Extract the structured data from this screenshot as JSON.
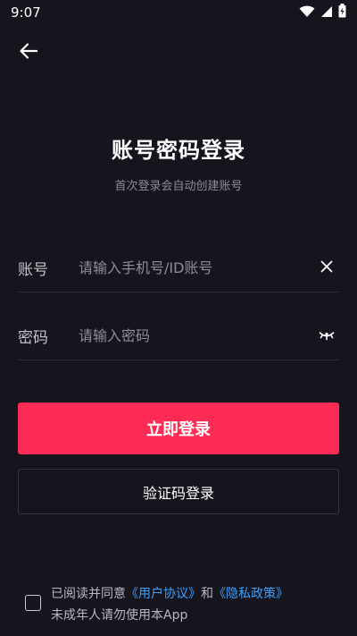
{
  "status_bar": {
    "time": "9:07",
    "icons": [
      "wifi-icon",
      "signal-icon",
      "battery-icon"
    ]
  },
  "header": {
    "back_icon": "arrow-left-icon"
  },
  "title": "账号密码登录",
  "subtitle": "首次登录会自动创建账号",
  "account_field": {
    "label": "账号",
    "placeholder": "请输入手机号/ID账号",
    "value": "",
    "clear_icon": "close-icon"
  },
  "password_field": {
    "label": "密码",
    "placeholder": "请输入密码",
    "value": "",
    "toggle_icon": "eye-closed-icon"
  },
  "buttons": {
    "login": "立即登录",
    "code_login": "验证码登录"
  },
  "agreement": {
    "prefix": "已阅读并同意",
    "user_agreement": "《用户协议》",
    "and": "和",
    "privacy_policy": "《隐私政策》",
    "minor_notice": "未成年人请勿使用本App",
    "checked": false
  },
  "colors": {
    "background": "#16141d",
    "accent": "#fe2c55",
    "link": "#3aa1ff"
  }
}
